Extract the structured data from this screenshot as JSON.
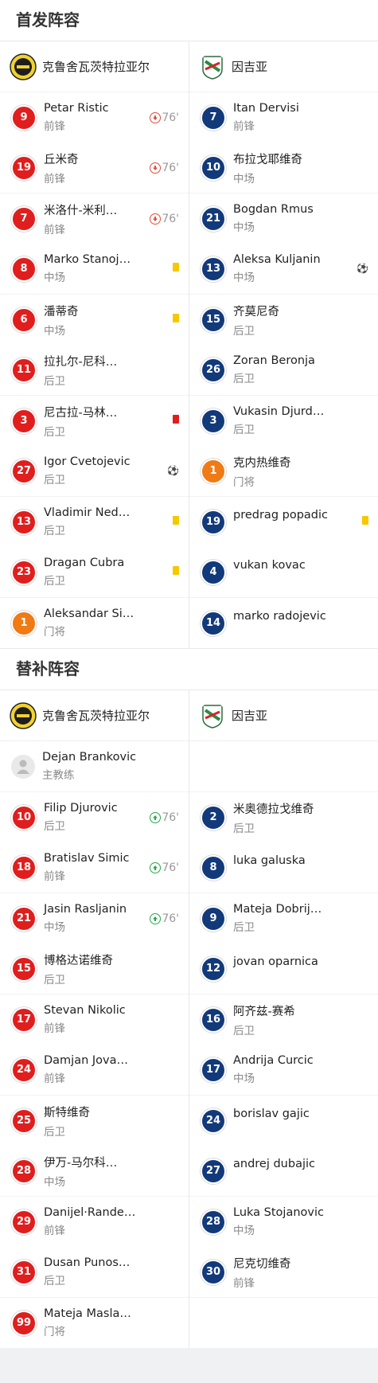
{
  "starting": {
    "title": "首发阵容",
    "home_team": "克鲁舍瓦茨特拉亚尔",
    "away_team": "因吉亚",
    "home": [
      {
        "num": "9",
        "name": "Petar Ristic",
        "pos": "前锋",
        "event": "sub-out",
        "minute": "76'",
        "color": "red"
      },
      {
        "num": "19",
        "name": "丘米奇",
        "pos": "前锋",
        "event": "sub-out",
        "minute": "76'",
        "color": "red"
      },
      {
        "num": "7",
        "name": "米洛什-米利…",
        "pos": "前锋",
        "event": "sub-out",
        "minute": "76'",
        "color": "red"
      },
      {
        "num": "8",
        "name": "Marko Stanoj…",
        "pos": "中场",
        "event": "yellow",
        "minute": "",
        "color": "red"
      },
      {
        "num": "6",
        "name": "潘蒂奇",
        "pos": "中场",
        "event": "yellow",
        "minute": "",
        "color": "red"
      },
      {
        "num": "11",
        "name": "拉扎尔-尼科…",
        "pos": "后卫",
        "event": "",
        "minute": "",
        "color": "red"
      },
      {
        "num": "3",
        "name": "尼古拉-马林…",
        "pos": "后卫",
        "event": "red",
        "minute": "",
        "color": "red"
      },
      {
        "num": "27",
        "name": "Igor Cvetojevic",
        "pos": "后卫",
        "event": "goal",
        "minute": "",
        "color": "red"
      },
      {
        "num": "13",
        "name": "Vladimir Ned…",
        "pos": "后卫",
        "event": "yellow",
        "minute": "",
        "color": "red"
      },
      {
        "num": "23",
        "name": "Dragan Cubra",
        "pos": "后卫",
        "event": "yellow",
        "minute": "",
        "color": "red"
      },
      {
        "num": "1",
        "name": "Aleksandar Si…",
        "pos": "门将",
        "event": "",
        "minute": "",
        "color": "orange"
      }
    ],
    "away": [
      {
        "num": "7",
        "name": "Itan Dervisi",
        "pos": "前锋",
        "event": "",
        "color": "blue"
      },
      {
        "num": "10",
        "name": "布拉戈耶维奇",
        "pos": "中场",
        "event": "",
        "color": "blue"
      },
      {
        "num": "21",
        "name": "Bogdan Rmus",
        "pos": "中场",
        "event": "",
        "color": "blue"
      },
      {
        "num": "13",
        "name": "Aleksa Kuljanin",
        "pos": "中场",
        "event": "goal",
        "color": "blue"
      },
      {
        "num": "15",
        "name": "齐莫尼奇",
        "pos": "后卫",
        "event": "",
        "color": "blue"
      },
      {
        "num": "26",
        "name": "Zoran Beronja",
        "pos": "后卫",
        "event": "",
        "color": "blue"
      },
      {
        "num": "3",
        "name": "Vukasin Djurd…",
        "pos": "后卫",
        "event": "",
        "color": "blue"
      },
      {
        "num": "1",
        "name": "克内热维奇",
        "pos": "门将",
        "event": "",
        "color": "orange"
      },
      {
        "num": "19",
        "name": "predrag popadic",
        "pos": "",
        "event": "yellow",
        "color": "blue"
      },
      {
        "num": "4",
        "name": "vukan kovac",
        "pos": "",
        "event": "",
        "color": "blue"
      },
      {
        "num": "14",
        "name": "marko radojevic",
        "pos": "",
        "event": "",
        "color": "blue"
      }
    ]
  },
  "subs": {
    "title": "替补阵容",
    "home_team": "克鲁舍瓦茨特拉亚尔",
    "away_team": "因吉亚",
    "coach": {
      "name": "Dejan Brankovic",
      "role": "主教练"
    },
    "home": [
      {
        "num": "10",
        "name": "Filip Djurovic",
        "pos": "后卫",
        "event": "sub-in",
        "minute": "76'",
        "color": "red"
      },
      {
        "num": "18",
        "name": "Bratislav Simic",
        "pos": "前锋",
        "event": "sub-in",
        "minute": "76'",
        "color": "red"
      },
      {
        "num": "21",
        "name": "Jasin Rasljanin",
        "pos": "中场",
        "event": "sub-in",
        "minute": "76'",
        "color": "red"
      },
      {
        "num": "15",
        "name": "博格达诺维奇",
        "pos": "后卫",
        "event": "",
        "minute": "",
        "color": "red"
      },
      {
        "num": "17",
        "name": "Stevan Nikolic",
        "pos": "前锋",
        "event": "",
        "minute": "",
        "color": "red"
      },
      {
        "num": "24",
        "name": "Damjan Jova…",
        "pos": "前锋",
        "event": "",
        "minute": "",
        "color": "red"
      },
      {
        "num": "25",
        "name": "斯特维奇",
        "pos": "后卫",
        "event": "",
        "minute": "",
        "color": "red"
      },
      {
        "num": "28",
        "name": "伊万-马尔科…",
        "pos": "中场",
        "event": "",
        "minute": "",
        "color": "red"
      },
      {
        "num": "29",
        "name": "Danijel·Rande…",
        "pos": "前锋",
        "event": "",
        "minute": "",
        "color": "red"
      },
      {
        "num": "31",
        "name": "Dusan Punos…",
        "pos": "后卫",
        "event": "",
        "minute": "",
        "color": "red"
      },
      {
        "num": "99",
        "name": "Mateja Masla…",
        "pos": "门将",
        "event": "",
        "minute": "",
        "color": "red"
      }
    ],
    "away": [
      {
        "num": "2",
        "name": "米奥德拉戈维奇",
        "pos": "后卫",
        "color": "blue"
      },
      {
        "num": "8",
        "name": "luka galuska",
        "pos": "",
        "color": "blue"
      },
      {
        "num": "9",
        "name": "Mateja Dobrij…",
        "pos": "后卫",
        "color": "blue"
      },
      {
        "num": "12",
        "name": "jovan oparnica",
        "pos": "",
        "color": "blue"
      },
      {
        "num": "16",
        "name": "阿齐兹-赛希",
        "pos": "后卫",
        "color": "blue"
      },
      {
        "num": "17",
        "name": "Andrija Curcic",
        "pos": "中场",
        "color": "blue"
      },
      {
        "num": "24",
        "name": "borislav gajic",
        "pos": "",
        "color": "blue"
      },
      {
        "num": "27",
        "name": "andrej dubajic",
        "pos": "",
        "color": "blue"
      },
      {
        "num": "28",
        "name": "Luka Stojanovic",
        "pos": "中场",
        "color": "blue"
      },
      {
        "num": "30",
        "name": "尼克切维奇",
        "pos": "前锋",
        "color": "blue"
      }
    ]
  }
}
